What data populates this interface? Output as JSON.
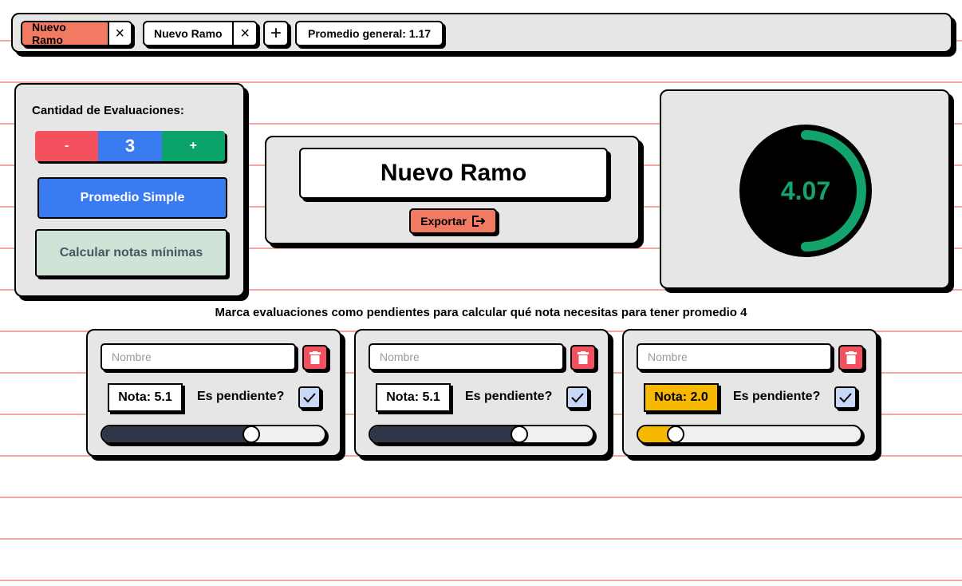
{
  "tabs": [
    {
      "label": "Nuevo Ramo",
      "active": true
    },
    {
      "label": "Nuevo Ramo",
      "active": false
    }
  ],
  "add_tab_icon": "plus-icon",
  "close_tab_icon": "close-icon",
  "general_average": "Promedio general: 1.17",
  "controls": {
    "eval_count_label": "Cantidad de Evaluaciones:",
    "minus_label": "-",
    "count": "3",
    "plus_label": "+",
    "simple_avg_label": "Promedio Simple",
    "min_grades_label": "Calcular notas mínimas"
  },
  "course": {
    "name": "Nuevo Ramo",
    "export_label": "Exportar"
  },
  "average_gauge": {
    "value": "4.07",
    "fraction": 0.5,
    "color": "#12a46b"
  },
  "instruction": "Marca evaluaciones como pendientes para calcular qué nota necesitas para tener promedio 4",
  "evaluations": [
    {
      "name_placeholder": "Nombre",
      "grade_label": "Nota: 5.1",
      "pending_label": "Es pendiente?",
      "pending": true,
      "slider_fraction": 0.67,
      "accent": "#2f3747",
      "badge_color": "#ffffff"
    },
    {
      "name_placeholder": "Nombre",
      "grade_label": "Nota: 5.1",
      "pending_label": "Es pendiente?",
      "pending": true,
      "slider_fraction": 0.67,
      "accent": "#2f3747",
      "badge_color": "#ffffff"
    },
    {
      "name_placeholder": "Nombre",
      "grade_label": "Nota: 2.0",
      "pending_label": "Es pendiente?",
      "pending": true,
      "slider_fraction": 0.17,
      "accent": "#f6b800",
      "badge_color": "#f6b800"
    }
  ],
  "colors": {
    "accent_red": "#f27a62",
    "danger": "#f4515f",
    "primary_blue": "#3b7bf2",
    "success_green": "#0ca36a",
    "ruled_line": "#f4a9a0"
  }
}
